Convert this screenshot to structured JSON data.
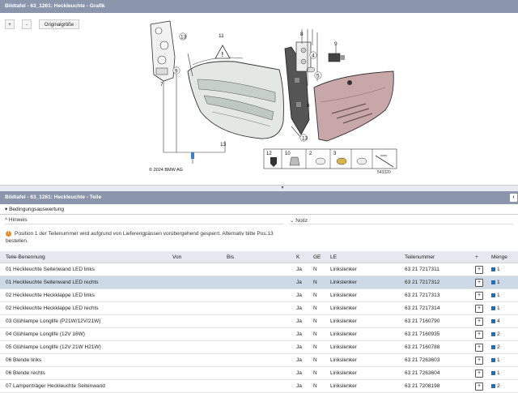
{
  "top_panel": {
    "title": "Bildtafel - 63_1261: Heckleuchte - Grafik",
    "zoom_in_label": "+",
    "zoom_out_label": "-",
    "original_size_label": "Originalgröße"
  },
  "diagram": {
    "callouts": [
      "13",
      "11",
      "7",
      "9",
      "8",
      "4",
      "5",
      "9",
      "6",
      "1",
      "10",
      "2",
      "3",
      "13",
      "12",
      "10",
      "2",
      "3"
    ],
    "copyright": "© 2024 BMW AG",
    "ref_number": "543320"
  },
  "bottom_panel": {
    "title": "Bildtafel - 63_1261: Heckleuchte - Teile",
    "collapse_icon": "‹",
    "condition_label": "Bedingungsauswertung",
    "hint_header": "Hinweis",
    "notes_header": "Notiz",
    "hint_text": "Position 1 der Teilenummer wird aufgrund von Lieferengpässen vorübergehend gesperrt. Alternativ bitte Pos.13 bestellen."
  },
  "table": {
    "columns": [
      "Teile-Benennung",
      "Von",
      "Bis",
      "K",
      "GE",
      "LE",
      "Teilenummer",
      "+",
      "Menge"
    ],
    "rows": [
      {
        "name": "01 Heckleuchte Seitenwand LED links",
        "von": "",
        "bis": "",
        "k": "Ja",
        "ge": "N",
        "le": "Linkslenker",
        "nr": "63 21 7217311",
        "plus": "+",
        "menge": "1"
      },
      {
        "name": "01 Heckleuchte Seitenwand LED rechts",
        "von": "",
        "bis": "",
        "k": "Ja",
        "ge": "N",
        "le": "Linkslenker",
        "nr": "63 21 7217312",
        "plus": "+",
        "menge": "1"
      },
      {
        "name": "02 Heckleuchte Heckklappe LED links",
        "von": "",
        "bis": "",
        "k": "Ja",
        "ge": "N",
        "le": "Linkslenker",
        "nr": "63 21 7217313",
        "plus": "+",
        "menge": "1"
      },
      {
        "name": "02 Heckleuchte Heckklappe LED rechts",
        "von": "",
        "bis": "",
        "k": "Ja",
        "ge": "N",
        "le": "Linkslenker",
        "nr": "63 21 7217314",
        "plus": "+",
        "menge": "1"
      },
      {
        "name": "03 Glühlampe Longlife (P21W/12V/21W)",
        "von": "",
        "bis": "",
        "k": "Ja",
        "ge": "N",
        "le": "Linkslenker",
        "nr": "63 21 7160790",
        "plus": "+",
        "menge": "4"
      },
      {
        "name": "04 Glühlampe Longlife (12V 16W)",
        "von": "",
        "bis": "",
        "k": "Ja",
        "ge": "N",
        "le": "Linkslenker",
        "nr": "63 21 7160935",
        "plus": "+",
        "menge": "2"
      },
      {
        "name": "05 Glühlampe Longlife (12V 21W H21W)",
        "von": "",
        "bis": "",
        "k": "Ja",
        "ge": "N",
        "le": "Linkslenker",
        "nr": "63 21 7160788",
        "plus": "+",
        "menge": "2"
      },
      {
        "name": "06 Blende links",
        "von": "",
        "bis": "",
        "k": "Ja",
        "ge": "N",
        "le": "Linkslenker",
        "nr": "63 21 7263603",
        "plus": "+",
        "menge": "1"
      },
      {
        "name": "06 Blende rechts",
        "von": "",
        "bis": "",
        "k": "Ja",
        "ge": "N",
        "le": "Linkslenker",
        "nr": "63 21 7263604",
        "plus": "+",
        "menge": "1"
      },
      {
        "name": "07 Lampenträger Heckleuchte Seitenwand",
        "von": "",
        "bis": "",
        "k": "Ja",
        "ge": "N",
        "le": "Linkslenker",
        "nr": "63 21 7208198",
        "plus": "+",
        "menge": "2"
      }
    ]
  },
  "colors": {
    "titlebar": "#8b96ad",
    "selected_row": "#cdd9e7",
    "warning": "#f08b16"
  }
}
